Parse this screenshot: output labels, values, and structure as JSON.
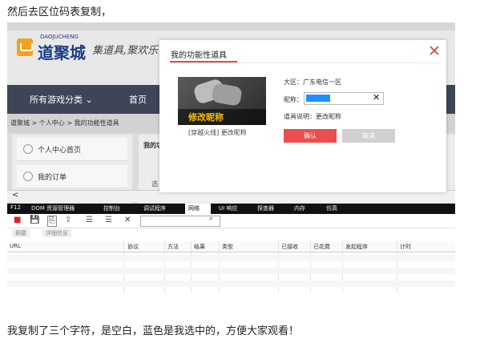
{
  "caption_top": "然后去区位码表复制，",
  "caption_bottom": "我复制了三个字符，是空白，蓝色是我选中的，方便大家观看！",
  "site": {
    "logo_small": "DAOJUCHENG",
    "logo_text": "道聚城",
    "slogan": "集道具,聚欢乐",
    "nav": [
      "所有游戏分类 ⌄",
      "首页"
    ],
    "breadcrumb": "道聚城 > 个人中心 > 我的功能性道具",
    "side_items": [
      "个人中心首页",
      "我的订单"
    ],
    "right_tab": "我的功",
    "right_tab2": "选"
  },
  "dialog": {
    "title": "我的功能性道具",
    "close_icon": "close-icon",
    "image_label": "修改昵称",
    "image_caption": "[穿越火线] 更改昵称",
    "region": "大区：广东电信一区",
    "nickname_label": "昵称：",
    "clear_icon": "✕",
    "description": "道具说明：更改昵称",
    "ok_label": "确认",
    "cancel_label": "取消",
    "accent": "#e34b4b"
  },
  "devtools": {
    "tabs": [
      "F12",
      "DOM 资源管理器",
      "控制台",
      "调试程序",
      "网络",
      "UI 响应",
      "探查器",
      "内存",
      "仿真"
    ],
    "active_tab": "网络",
    "toolbar_icons": [
      "■",
      "💾",
      "⎘",
      "⇪",
      "☰",
      "✕"
    ],
    "search_icon": "⌕",
    "sub_tabs": [
      "摘要",
      "详细信息"
    ],
    "columns": [
      "URL",
      "协议",
      "方法",
      "结果",
      "类型",
      "已接收",
      "已花费",
      "发起程序",
      "计时"
    ]
  }
}
